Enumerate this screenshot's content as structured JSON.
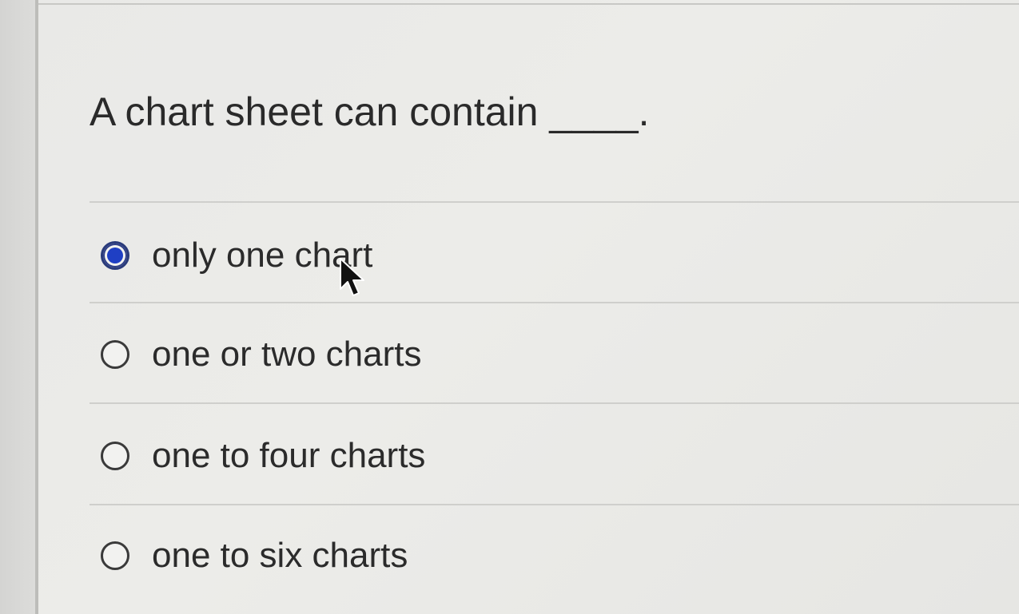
{
  "question": {
    "text": "A chart sheet can contain ____."
  },
  "options": [
    {
      "label": "only one chart",
      "selected": true
    },
    {
      "label": "one or two charts",
      "selected": false
    },
    {
      "label": "one to four charts",
      "selected": false
    },
    {
      "label": "one to six charts",
      "selected": false
    }
  ],
  "colors": {
    "selected_radio": "#1f3fc4",
    "radio_border": "#3a3a3a",
    "panel_bg": "#ebebe8"
  },
  "icons": {
    "cursor": "mouse-pointer-icon"
  }
}
